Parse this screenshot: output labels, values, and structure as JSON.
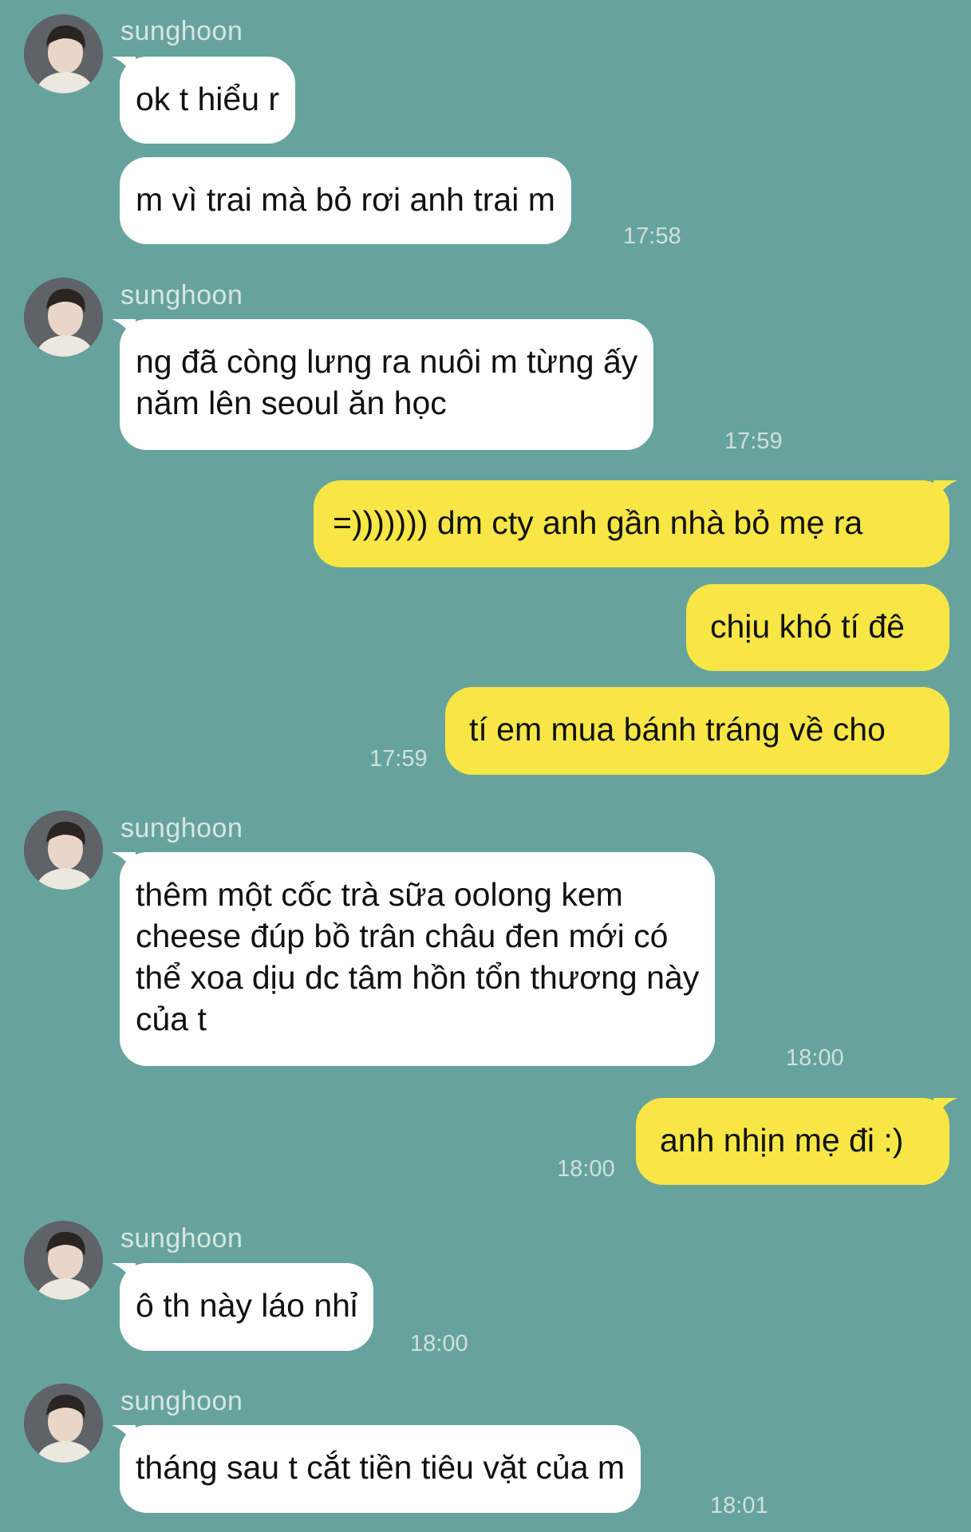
{
  "contact": {
    "name": "sunghoon"
  },
  "messages": [
    {
      "sender": "sunghoon",
      "text": "ok t hiểu r"
    },
    {
      "sender": "sunghoon",
      "text": "m vì trai mà bỏ rơi anh trai m",
      "time": "17:58"
    },
    {
      "sender": "sunghoon",
      "lines": [
        "ng đã còng lưng ra nuôi m từng ấy",
        "năm lên seoul ăn học"
      ],
      "time": "17:59"
    },
    {
      "sender": "me",
      "text": "=))))))) dm cty anh gần nhà bỏ mẹ ra"
    },
    {
      "sender": "me",
      "text": "chịu khó tí đê"
    },
    {
      "sender": "me",
      "text": "tí em mua bánh tráng về cho",
      "time": "17:59"
    },
    {
      "sender": "sunghoon",
      "lines": [
        "thêm một cốc trà sữa oolong kem",
        "cheese đúp bồ trân châu đen mới có",
        "thể xoa dịu dc tâm hồn tổn thương này",
        "của t"
      ],
      "time": "18:00"
    },
    {
      "sender": "me",
      "text": "anh nhịn mẹ đi :)",
      "time": "18:00"
    },
    {
      "sender": "sunghoon",
      "text": "ô th này láo nhỉ",
      "time": "18:00"
    },
    {
      "sender": "sunghoon",
      "text": "tháng sau t cắt tiền tiêu vặt của m",
      "time": "18:01"
    }
  ],
  "colors": {
    "background": "#67a39d",
    "incoming_bubble": "#ffffff",
    "outgoing_bubble": "#f7e645",
    "sender_name": "#d7e6e3",
    "timestamp": "#cfe0dd"
  }
}
